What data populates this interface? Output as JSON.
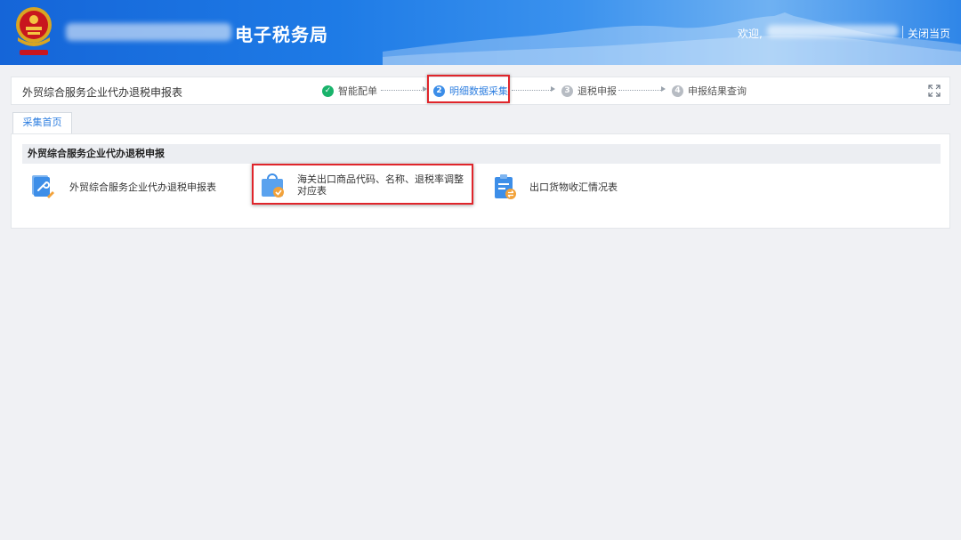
{
  "header": {
    "app_title": "电子税务局",
    "welcome_label": "欢迎,",
    "close_label": "关闭当页"
  },
  "wizard": {
    "form_title": "外贸综合服务企业代办退税申报表",
    "steps": [
      {
        "number": "✓",
        "label": "智能配单",
        "state": "done"
      },
      {
        "number": "2",
        "label": "明细数据采集",
        "state": "active"
      },
      {
        "number": "3",
        "label": "退税申报",
        "state": "pending"
      },
      {
        "number": "4",
        "label": "申报结果查询",
        "state": "pending"
      }
    ],
    "expand_icon": "fullscreen-icon"
  },
  "tabs": [
    {
      "label": "采集首页",
      "active": true
    }
  ],
  "section": {
    "title": "外贸综合服务企业代办退税申报",
    "items": [
      {
        "label": "外贸综合服务企业代办退税申报表",
        "icon": "document-wrench-icon"
      },
      {
        "label": "海关出口商品代码、名称、退税率调整对应表",
        "icon": "shopping-bag-check-icon",
        "highlighted": true
      },
      {
        "label": "出口货物收汇情况表",
        "icon": "clipboard-exchange-icon"
      }
    ]
  },
  "colors": {
    "header_blue": "#1e7be6",
    "active_blue": "#2f7fe0",
    "done_green": "#19b36b",
    "highlight_red": "#e0252b"
  }
}
